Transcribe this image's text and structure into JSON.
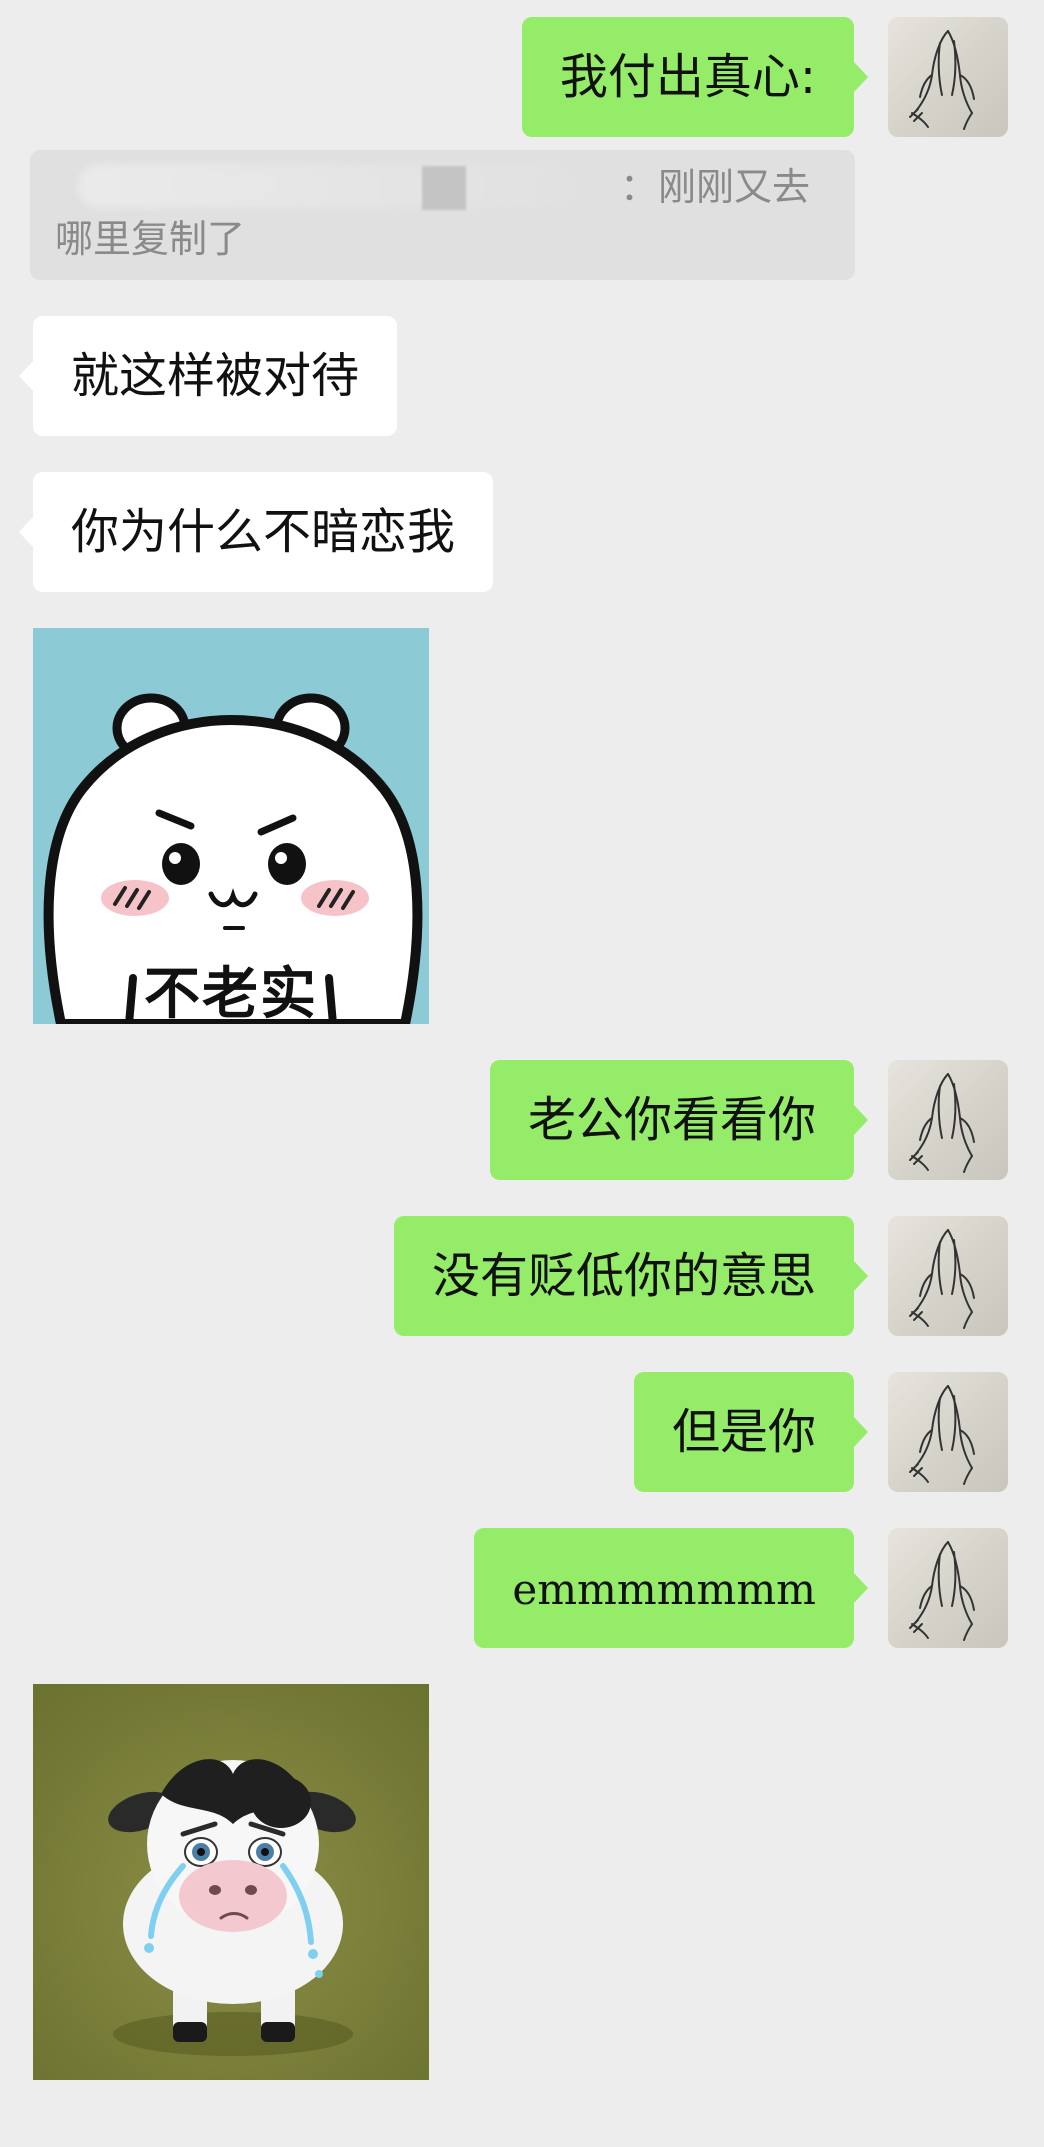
{
  "messages": [
    {
      "type": "out_text",
      "text": "我付出真心:"
    },
    {
      "type": "quote",
      "line1": "：刚刚又去",
      "line2": "哪里复制了"
    },
    {
      "type": "in_text",
      "text": "就这样被对待"
    },
    {
      "type": "in_text",
      "text": "你为什么不暗恋我"
    },
    {
      "type": "in_sticker",
      "caption": "不老实"
    },
    {
      "type": "out_text",
      "text": "老公你看看你"
    },
    {
      "type": "out_text",
      "text": "没有贬低你的意思"
    },
    {
      "type": "out_text",
      "text": "但是你"
    },
    {
      "type": "out_text",
      "text": "emmmmmmm"
    },
    {
      "type": "in_sticker",
      "caption": ""
    }
  ],
  "avatar_icon": "praying-hands-icon",
  "colors": {
    "background": "#ededed",
    "outgoing_bubble": "#95ec69",
    "incoming_bubble": "#ffffff",
    "quote_background": "#e0e0e0"
  }
}
